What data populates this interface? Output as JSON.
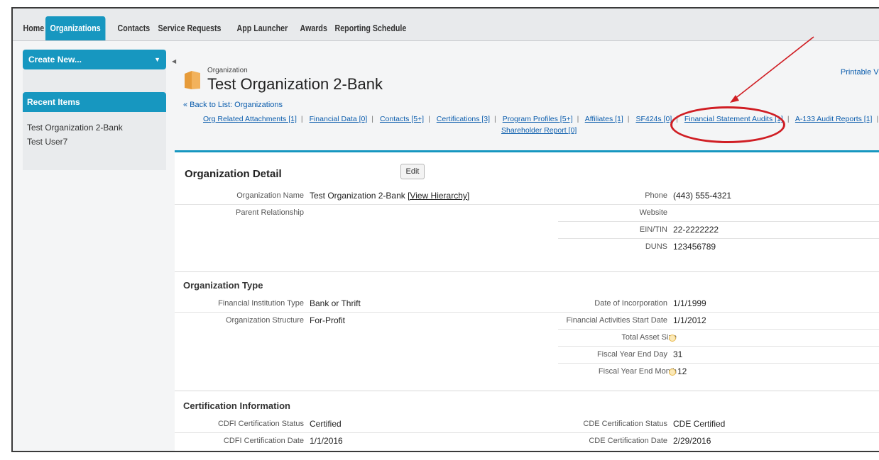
{
  "tabs": [
    "Home",
    "Organizations",
    "Contacts",
    "Service Requests",
    "App Launcher",
    "Awards",
    "Reporting Schedule"
  ],
  "active_tab": "Organizations",
  "sidebar": {
    "create_new": "Create New...",
    "recent_items_title": "Recent Items",
    "recent_items": [
      "Test Organization 2-Bank",
      "Test User7"
    ]
  },
  "header": {
    "record_type": "Organization",
    "title": "Test Organization 2-Bank",
    "printable_view": "Printable Vie",
    "back_link": "« Back to List: Organizations"
  },
  "related_links": [
    "Org Related Attachments [1]",
    "Financial Data [0]",
    "Contacts [5+]",
    "Certifications [3]",
    "Program Profiles [5+]",
    "Affiliates [1]",
    "SF424s [0]",
    "Financial Statement Audits [1]",
    "A-133 Audit Reports [1]",
    "Shareholder Report [0]"
  ],
  "detail": {
    "title": "Organization Detail",
    "edit_label": "Edit",
    "fields": {
      "org_name_label": "Organization Name",
      "org_name_value": "Test Organization 2-Bank",
      "view_hierarchy": "[View Hierarchy]",
      "parent_label": "Parent Relationship",
      "phone_label": "Phone",
      "phone_value": "(443) 555-4321",
      "website_label": "Website",
      "ein_label": "EIN/TIN",
      "ein_value": "22-2222222",
      "duns_label": "DUNS",
      "duns_value": "123456789"
    }
  },
  "org_type": {
    "title": "Organization Type",
    "fi_type_label": "Financial Institution Type",
    "fi_type_value": "Bank or Thrift",
    "structure_label": "Organization Structure",
    "structure_value": "For-Profit",
    "incorporation_label": "Date of Incorporation",
    "incorporation_value": "1/1/1999",
    "fa_start_label": "Financial Activities Start Date",
    "fa_start_value": "1/1/2012",
    "asset_label": "Total Asset Size",
    "fy_day_label": "Fiscal Year End Day",
    "fy_day_value": "31",
    "fy_month_label": "Fiscal Year End Month",
    "fy_month_value": "12"
  },
  "certification": {
    "title": "Certification Information",
    "cdfi_status_label": "CDFI Certification Status",
    "cdfi_status_value": "Certified",
    "cdfi_date_label": "CDFI Certification Date",
    "cdfi_date_value": "1/1/2016",
    "cde_status_label": "CDE Certification Status",
    "cde_status_value": "CDE Certified",
    "cde_date_label": "CDE Certification Date",
    "cde_date_value": "2/29/2016"
  },
  "colors": {
    "accent": "#1797c0",
    "link": "#0b5dad",
    "annotation": "#d01e24"
  }
}
